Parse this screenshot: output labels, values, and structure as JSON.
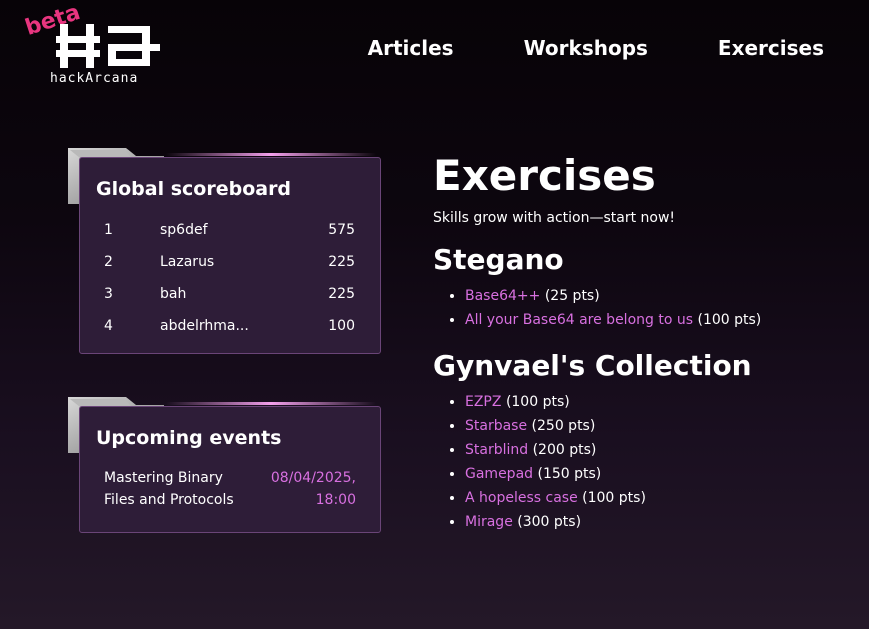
{
  "header": {
    "logo_badge": "beta",
    "logo_text": "hackArcana",
    "nav": [
      "Articles",
      "Workshops",
      "Exercises"
    ]
  },
  "scoreboard": {
    "title": "Global scoreboard",
    "rows": [
      {
        "rank": "1",
        "name": "sp6def",
        "points": "575"
      },
      {
        "rank": "2",
        "name": "Lazarus",
        "points": "225"
      },
      {
        "rank": "3",
        "name": "bah",
        "points": "225"
      },
      {
        "rank": "4",
        "name": "abdelrhma...",
        "points": "100"
      }
    ]
  },
  "events": {
    "title": "Upcoming events",
    "items": [
      {
        "name": "Mastering Binary Files and Protocols",
        "date": "08/04/2025, 18:00"
      }
    ]
  },
  "main": {
    "title": "Exercises",
    "subtitle": "Skills grow with action—start now!",
    "sections": [
      {
        "title": "Stegano",
        "exercises": [
          {
            "name": "Base64++",
            "points": "(25 pts)"
          },
          {
            "name": "All your Base64 are belong to us",
            "points": "(100 pts)"
          }
        ]
      },
      {
        "title": "Gynvael's Collection",
        "exercises": [
          {
            "name": "EZPZ",
            "points": "(100 pts)"
          },
          {
            "name": "Starbase",
            "points": "(250 pts)"
          },
          {
            "name": "Starblind",
            "points": "(200 pts)"
          },
          {
            "name": "Gamepad",
            "points": "(150 pts)"
          },
          {
            "name": "A hopeless case",
            "points": "(100 pts)"
          },
          {
            "name": "Mirage",
            "points": "(300 pts)"
          }
        ]
      }
    ]
  },
  "colors": {
    "accent": "#d870e0",
    "badge": "#e8357f",
    "card_bg": "#2e1d38"
  }
}
